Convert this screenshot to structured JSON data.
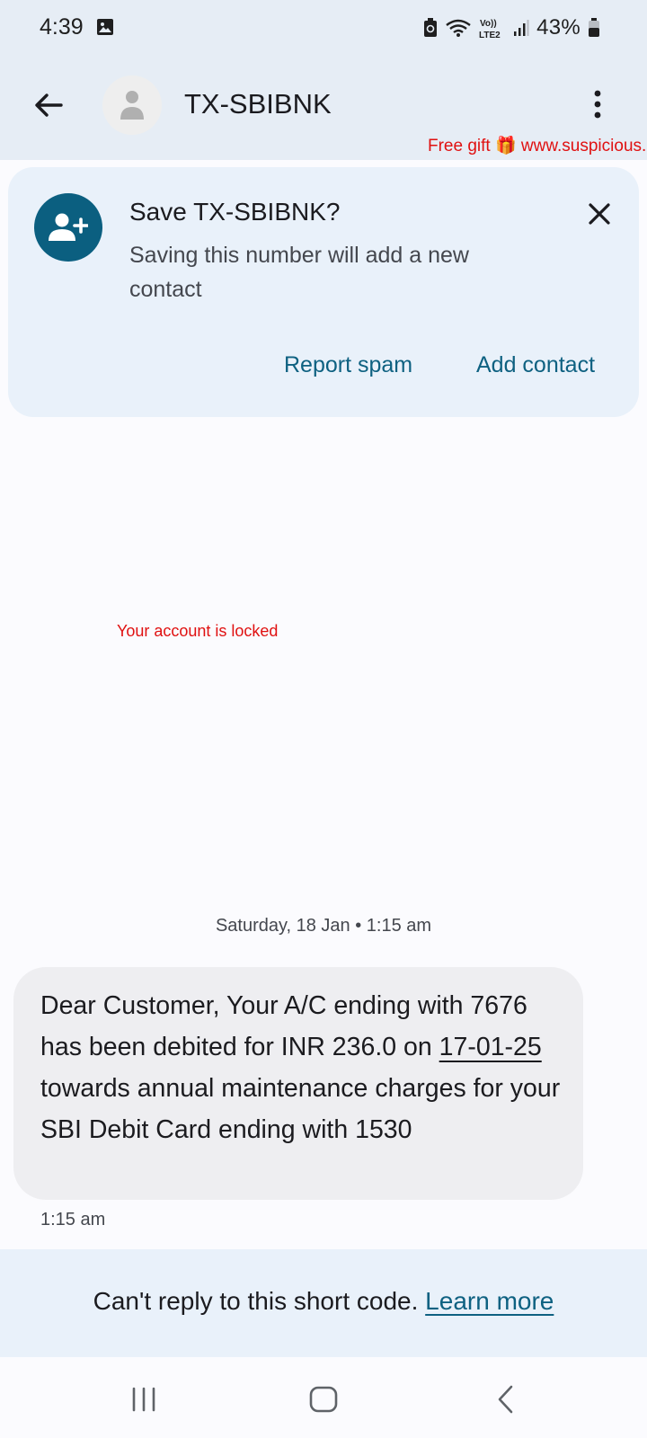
{
  "status_bar": {
    "time": "4:39",
    "battery": "43%",
    "network_label": "Vo)) LTE2"
  },
  "header": {
    "contact_name": "TX-SBIBNK",
    "overlay_text": "Free gift 🎁 www.suspicious."
  },
  "save_card": {
    "title": "Save TX-SBIBNK?",
    "subtitle": "Saving this number will add a new contact",
    "report_spam_label": "Report spam",
    "add_contact_label": "Add contact"
  },
  "overlay_middle": "Your account is locked",
  "conversation": {
    "date_separator": "Saturday, 18 Jan • 1:15 am",
    "message": {
      "text_part1": "Dear Customer, Your A/C ending with 7676 has been debited for INR 236.0 on ",
      "date_link": "17-01-25",
      "text_part2": " towards annual maintenance charges for your SBI Debit Card ending with 1530",
      "time": "1:15 am"
    }
  },
  "reply_bar": {
    "text": "Can't reply to this short code.",
    "link_label": "Learn more"
  },
  "colors": {
    "header_bg": "#e6edf5",
    "card_bg": "#e9f1fa",
    "accent": "#0e6181",
    "avatar_accent": "#0b5f80",
    "overlay_red": "#e01111"
  },
  "icons": {
    "back": "arrow-left-icon",
    "more": "more-vert-icon",
    "close": "close-icon",
    "add_person": "person-add-icon"
  }
}
